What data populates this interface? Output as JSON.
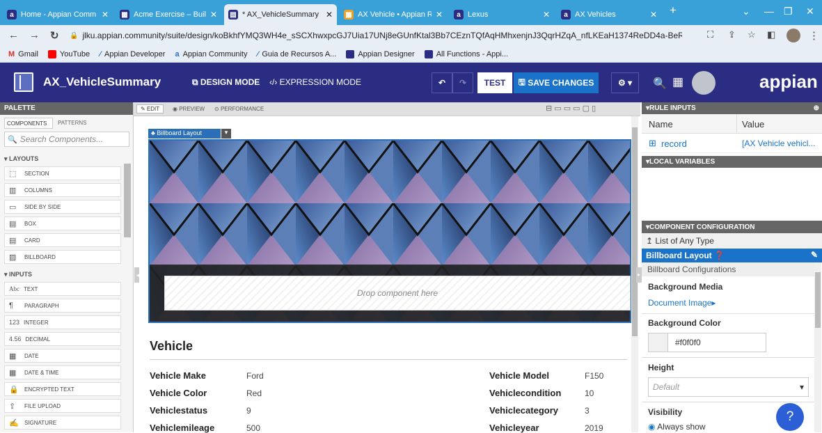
{
  "browser": {
    "tabs": [
      {
        "title": "Home - Appian Comm",
        "icon": "appian-a-icon"
      },
      {
        "title": "Acme Exercise – Build",
        "icon": "grid-icon"
      },
      {
        "title": "* AX_VehicleSummary",
        "icon": "interface-icon"
      },
      {
        "title": "AX Vehicle • Appian R",
        "icon": "record-icon"
      },
      {
        "title": "Lexus",
        "icon": "appian-a-icon"
      },
      {
        "title": "AX Vehicles",
        "icon": "appian-a-icon"
      }
    ],
    "url": "jlku.appian.community/suite/design/koBkhfYMQ3WH4e_sSCXhwxpcGJ7Uia17UNj8eGUnfKtal3Bb7CEznTQfAqHMhxenjnJ3QqrHZqA_nfLKEaH1374ReDD4a-BeRjflQ",
    "bookmarks": [
      "Gmail",
      "YouTube",
      "Appian Developer",
      "Appian Community",
      "Guia de Recursos A...",
      "Appian Designer",
      "All Functions - Appi..."
    ]
  },
  "header": {
    "title": "AX_VehicleSummary",
    "design_mode": "DESIGN MODE",
    "expression_mode": "EXPRESSION MODE",
    "test": "TEST",
    "save": "SAVE CHANGES",
    "logo": "appian"
  },
  "palette": {
    "title": "PALETTE",
    "tabs": [
      "COMPONENTS",
      "PATTERNS"
    ],
    "search_placeholder": "Search Components...",
    "layouts_head": "LAYOUTS",
    "layouts": [
      {
        "label": "SECTION",
        "icon": "section-icon"
      },
      {
        "label": "COLUMNS",
        "icon": "columns-icon"
      },
      {
        "label": "SIDE BY SIDE",
        "icon": "side-by-side-icon"
      },
      {
        "label": "BOX",
        "icon": "box-icon"
      },
      {
        "label": "CARD",
        "icon": "card-icon"
      },
      {
        "label": "BILLBOARD",
        "icon": "billboard-icon"
      }
    ],
    "inputs_head": "INPUTS",
    "inputs": [
      {
        "label": "TEXT",
        "icon": "text-icon",
        "glyph": "Abc"
      },
      {
        "label": "PARAGRAPH",
        "icon": "paragraph-icon",
        "glyph": "¶"
      },
      {
        "label": "INTEGER",
        "icon": "integer-icon",
        "glyph": "123"
      },
      {
        "label": "DECIMAL",
        "icon": "decimal-icon",
        "glyph": "4.56"
      },
      {
        "label": "DATE",
        "icon": "calendar-icon",
        "glyph": "▦"
      },
      {
        "label": "DATE & TIME",
        "icon": "datetime-icon",
        "glyph": "▦"
      },
      {
        "label": "ENCRYPTED TEXT",
        "icon": "lock-icon",
        "glyph": "🔒"
      },
      {
        "label": "FILE UPLOAD",
        "icon": "upload-icon",
        "glyph": "⇪"
      },
      {
        "label": "SIGNATURE",
        "icon": "signature-icon",
        "glyph": "✍"
      }
    ]
  },
  "canvas": {
    "tabs": [
      "EDIT",
      "PREVIEW",
      "PERFORMANCE"
    ],
    "billboard_tag": "Billboard Layout",
    "drop_text": "Drop component here",
    "section_title": "Vehicle",
    "fields_left": [
      {
        "label": "Vehicle Make",
        "value": "Ford"
      },
      {
        "label": "Vehicle Color",
        "value": "Red"
      },
      {
        "label": "Vehiclestatus",
        "value": "9"
      },
      {
        "label": "Vehiclemileage",
        "value": "500"
      }
    ],
    "fields_right": [
      {
        "label": "Vehicle Model",
        "value": "F150"
      },
      {
        "label": "Vehiclecondition",
        "value": "10"
      },
      {
        "label": "Vehiclecategory",
        "value": "3"
      },
      {
        "label": "Vehicleyear",
        "value": "2019"
      }
    ]
  },
  "right": {
    "rule_inputs_head": "RULE INPUTS",
    "col_name": "Name",
    "col_value": "Value",
    "rule_name": "record",
    "rule_value": "[AX Vehicle vehicl...",
    "local_vars_head": "LOCAL VARIABLES",
    "config_head": "COMPONENT CONFIGURATION",
    "list_of_any": "List of Any Type",
    "billboard_layout": "Billboard Layout",
    "billboard_configs": "Billboard Configurations",
    "bg_media_label": "Background Media",
    "bg_media_value": "Document Image",
    "bg_color_label": "Background Color",
    "bg_color_value": "#f0f0f0",
    "height_label": "Height",
    "height_value": "Default",
    "visibility_label": "Visibility",
    "visibility_value": "Always show"
  },
  "colors": {
    "header": "#2b2d83",
    "accent": "#1a73c8",
    "tabbar": "#3aa0d8"
  }
}
